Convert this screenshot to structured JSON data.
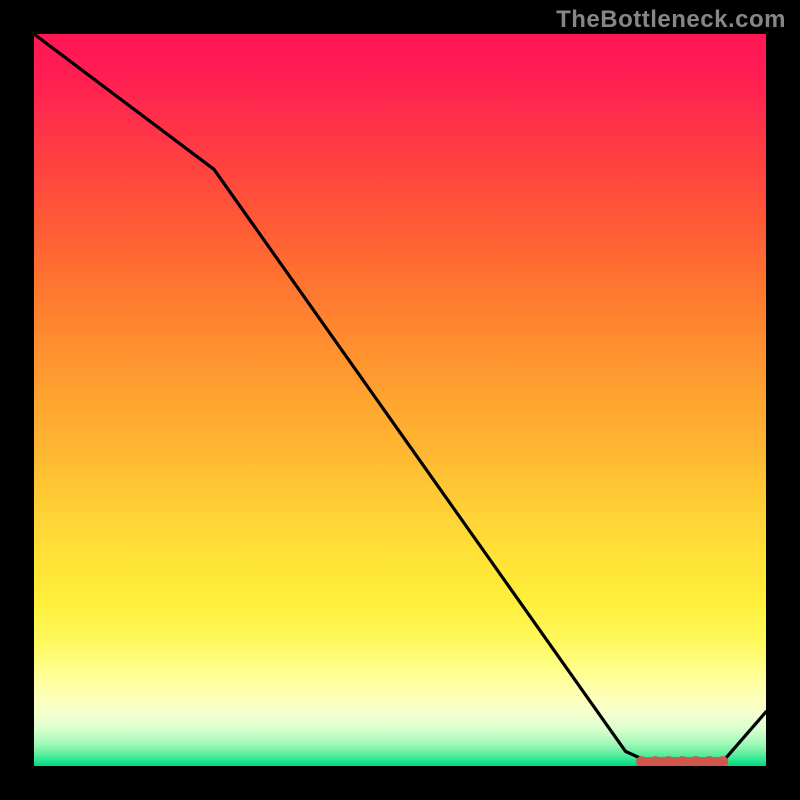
{
  "watermark": "TheBottleneck.com",
  "chart_data": {
    "type": "line",
    "x": [
      0.0,
      0.246,
      0.808,
      0.83,
      0.845,
      0.902,
      0.91,
      0.92,
      0.931,
      0.941,
      1.0
    ],
    "y": [
      1.0,
      0.815,
      0.02,
      0.01,
      0.008,
      0.005,
      0.005,
      0.005,
      0.005,
      0.006,
      0.074
    ],
    "title": "",
    "xlabel": "",
    "ylabel": "",
    "xlim": [
      0,
      1
    ],
    "ylim": [
      0,
      1
    ],
    "highlight": {
      "x_start": 0.83,
      "x_end": 0.941,
      "y": 0.006
    },
    "legend": null,
    "grid": false,
    "background_gradient": {
      "orientation": "vertical",
      "stops": [
        {
          "pos": 0.0,
          "color": "#ff1754"
        },
        {
          "pos": 0.5,
          "color": "#ffa430"
        },
        {
          "pos": 0.85,
          "color": "#ffff8d"
        },
        {
          "pos": 1.0,
          "color": "#00d67a"
        }
      ]
    }
  }
}
